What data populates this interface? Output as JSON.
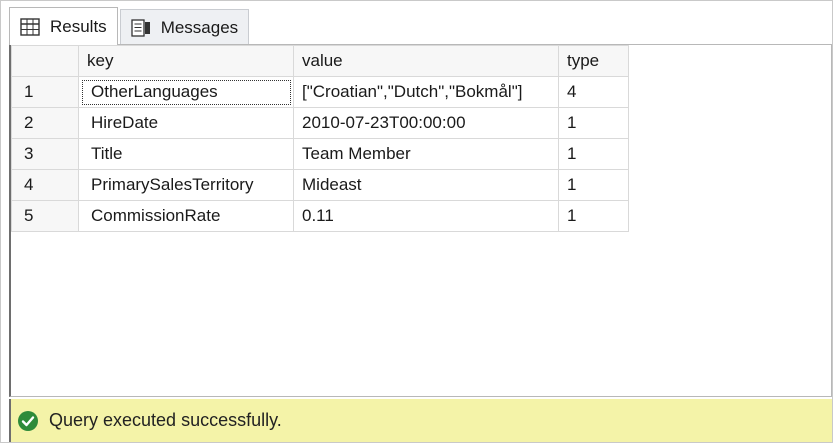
{
  "tabs": [
    {
      "label": "Results",
      "icon": "grid-icon",
      "active": true
    },
    {
      "label": "Messages",
      "icon": "messages-icon",
      "active": false
    }
  ],
  "grid": {
    "columns": [
      "",
      "key",
      "value",
      "type"
    ],
    "rows": [
      {
        "num": "1",
        "key": "OtherLanguages",
        "value": "[\"Croatian\",\"Dutch\",\"Bokmål\"]",
        "type": "4"
      },
      {
        "num": "2",
        "key": "HireDate",
        "value": "2010-07-23T00:00:00",
        "type": "1"
      },
      {
        "num": "3",
        "key": "Title",
        "value": "Team Member",
        "type": "1"
      },
      {
        "num": "4",
        "key": "PrimarySalesTerritory",
        "value": "Mideast",
        "type": "1"
      },
      {
        "num": "5",
        "key": "CommissionRate",
        "value": "0.11",
        "type": "1"
      }
    ]
  },
  "status": {
    "icon": "success-check-icon",
    "text": "Query executed successfully.",
    "background": "#f4f3a8",
    "icon_color": "#2e8b3a"
  }
}
